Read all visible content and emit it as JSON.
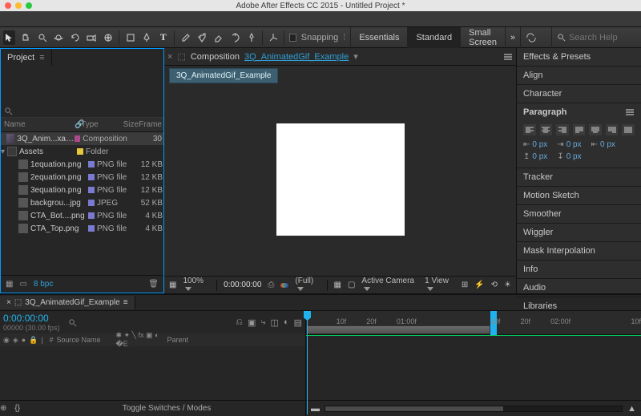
{
  "app": {
    "title": "Adobe After Effects CC 2015 - Untitled Project *"
  },
  "toolbar": {
    "snapping_label": "Snapping"
  },
  "workspaces": {
    "essentials": "Essentials",
    "standard": "Standard",
    "small_screen": "Small Screen",
    "search_placeholder": "Search Help"
  },
  "project": {
    "tab_label": "Project",
    "columns": {
      "name": "Name",
      "type": "Type",
      "size": "Size",
      "frame": "Frame"
    },
    "items": [
      {
        "name": "3Q_Anim...xample",
        "type": "Composition",
        "size": "",
        "frame": "30"
      },
      {
        "name": "Assets",
        "type": "Folder",
        "size": "",
        "frame": ""
      },
      {
        "name": "1equation.png",
        "type": "PNG file",
        "size": "12 KB",
        "frame": ""
      },
      {
        "name": "2equation.png",
        "type": "PNG file",
        "size": "12 KB",
        "frame": ""
      },
      {
        "name": "3equation.png",
        "type": "PNG file",
        "size": "12 KB",
        "frame": ""
      },
      {
        "name": "backgrou...jpg",
        "type": "JPEG",
        "size": "52 KB",
        "frame": ""
      },
      {
        "name": "CTA_Bot....png",
        "type": "PNG file",
        "size": "4 KB",
        "frame": ""
      },
      {
        "name": "CTA_Top.png",
        "type": "PNG file",
        "size": "4 KB",
        "frame": ""
      }
    ],
    "footer_bpc": "8 bpc"
  },
  "composition": {
    "tab_prefix": "Composition",
    "name": "3Q_AnimatedGif_Example",
    "subtab": "3Q_AnimatedGif_Example"
  },
  "viewer_footer": {
    "zoom": "100%",
    "time": "0:00:00:00",
    "res": "(Full)",
    "camera": "Active Camera",
    "view": "1 View"
  },
  "right_panels": {
    "effects": "Effects & Presets",
    "align": "Align",
    "character": "Character",
    "paragraph": "Paragraph",
    "tracker": "Tracker",
    "motion_sketch": "Motion Sketch",
    "smoother": "Smoother",
    "wiggler": "Wiggler",
    "mask": "Mask Interpolation",
    "info": "Info",
    "audio": "Audio",
    "libraries": "Libraries",
    "indent_val": "0 px"
  },
  "timeline": {
    "tab_label": "3Q_AnimatedGif_Example",
    "timecode": "0:00:00:00",
    "frame_info": "00000 (30.00 fps)",
    "col_source": "Source Name",
    "col_parent": "Parent",
    "ticks": [
      "10f",
      "20f",
      "01:00f",
      "10f",
      "20f",
      "02:00f",
      "10f"
    ],
    "footer_toggle": "Toggle Switches / Modes"
  }
}
